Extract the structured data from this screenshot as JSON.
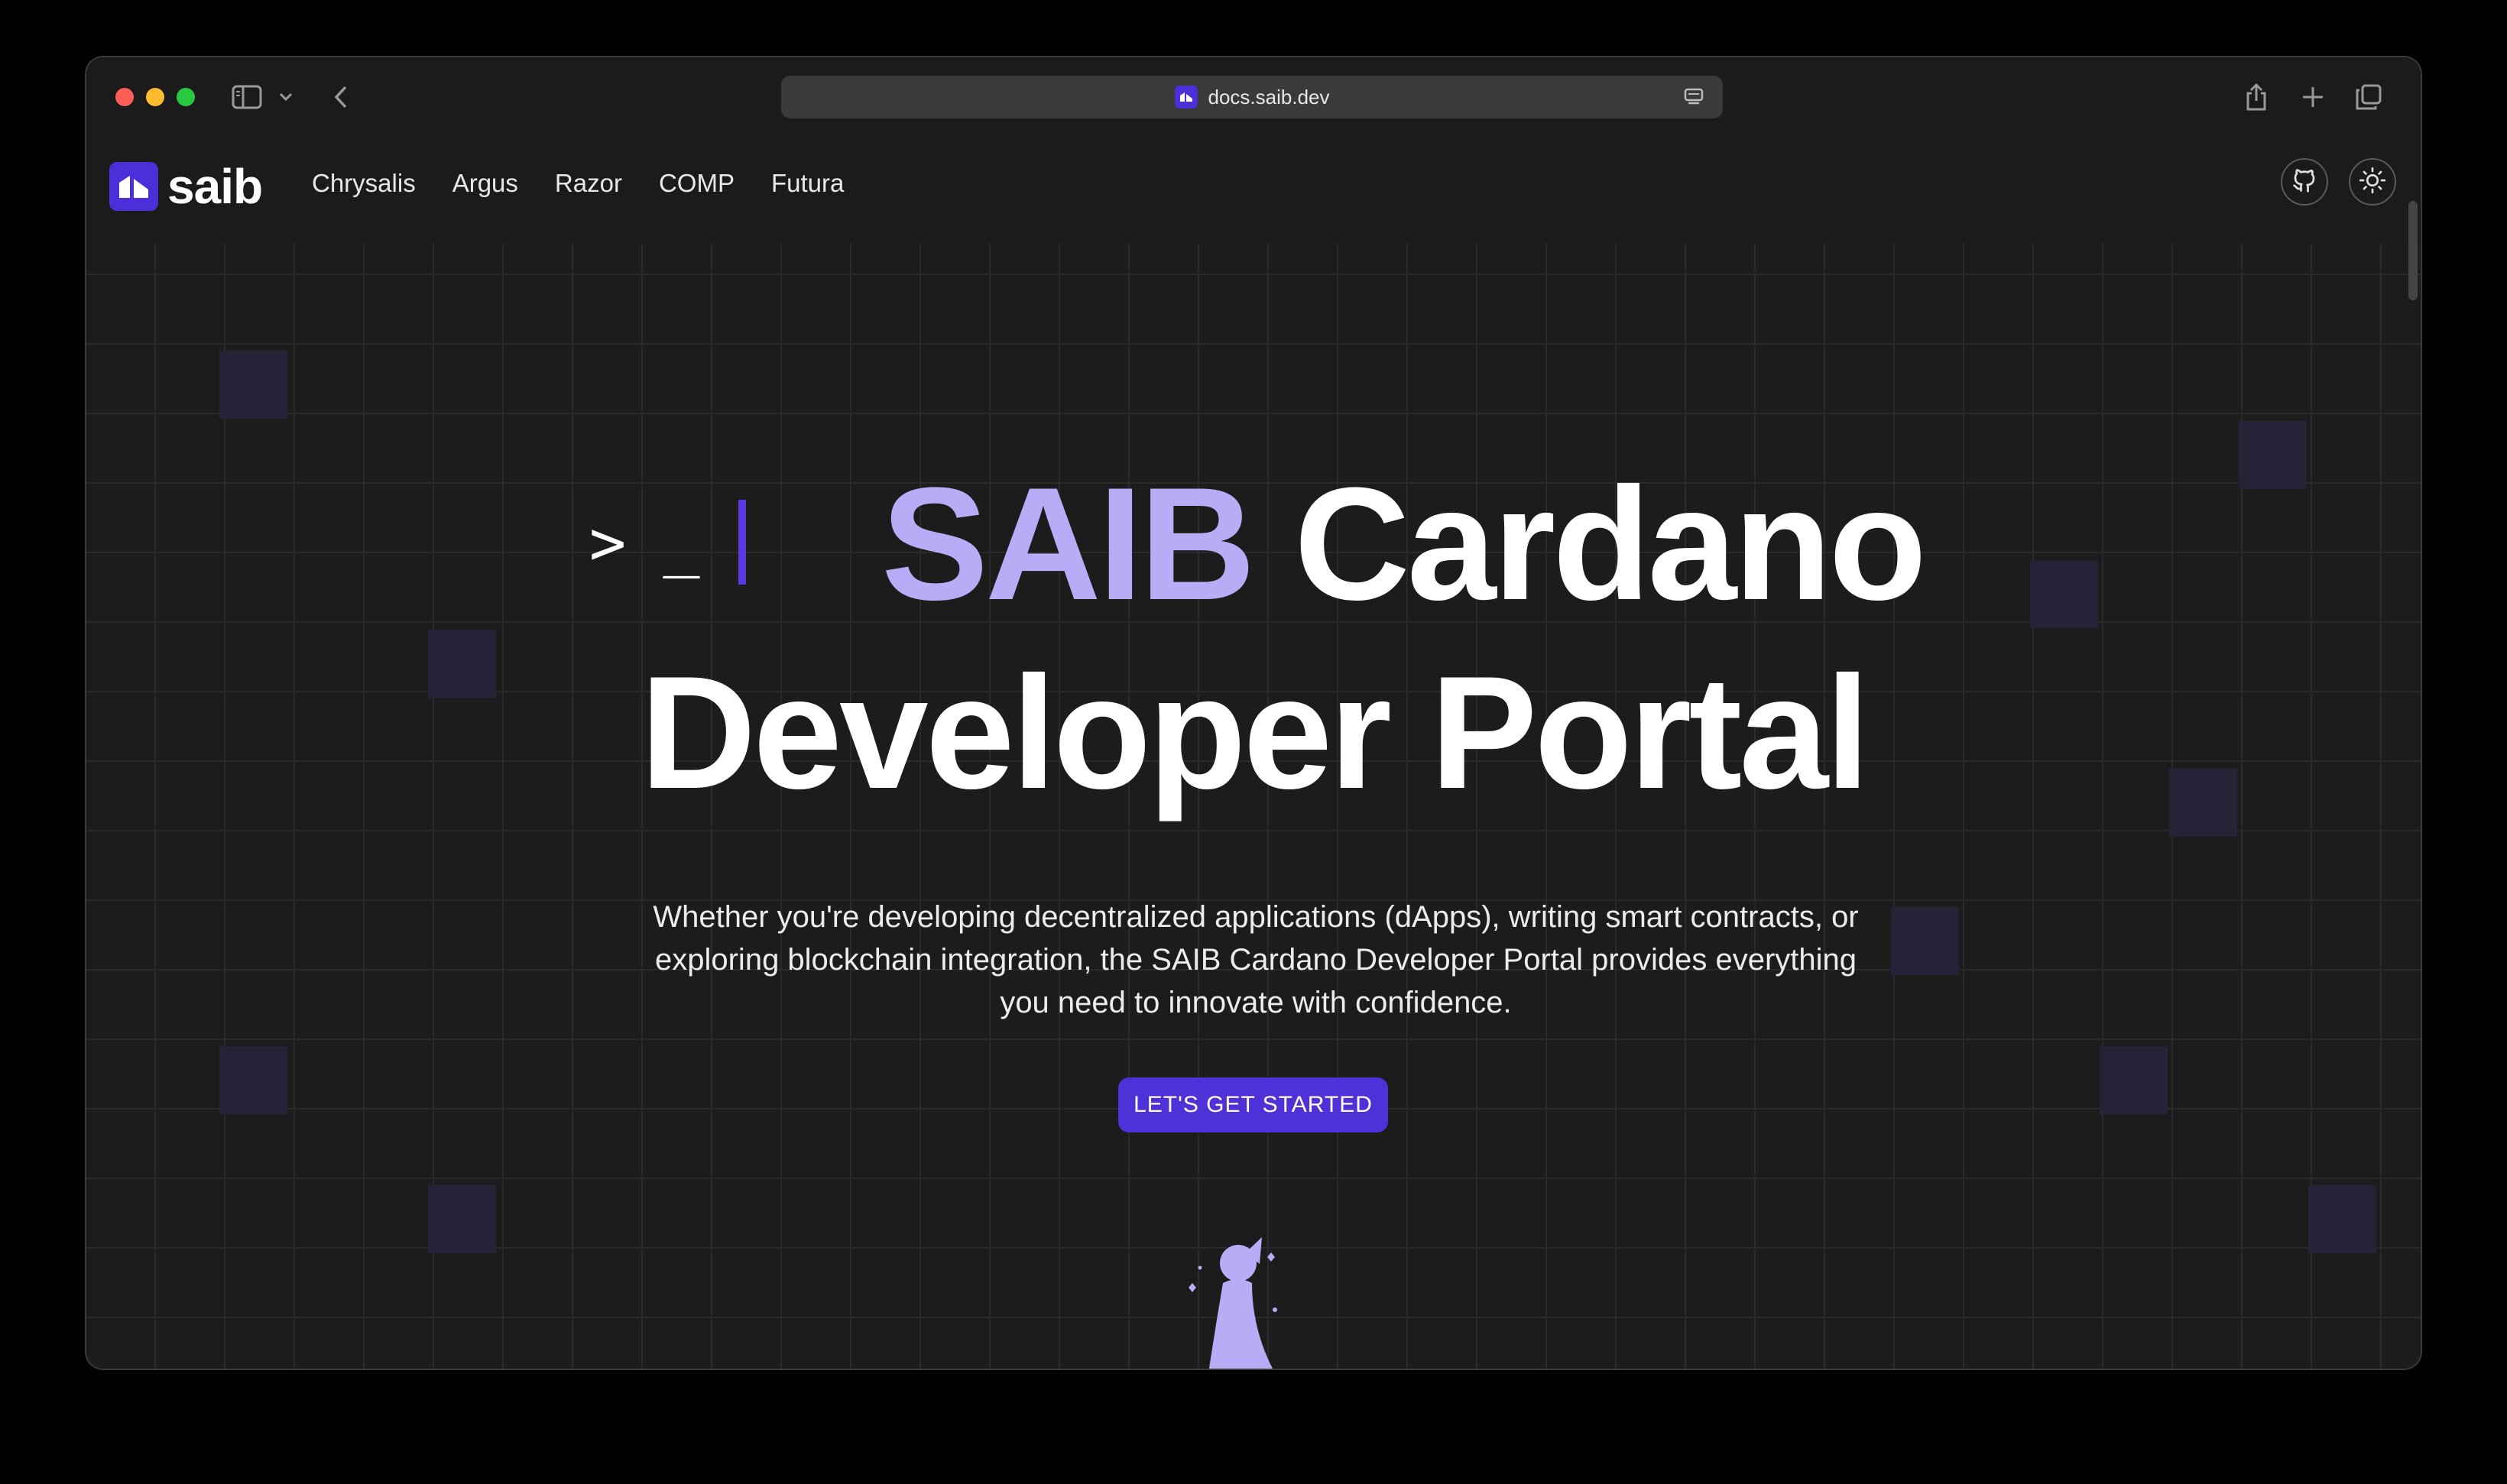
{
  "browser": {
    "url": "docs.saib.dev"
  },
  "site": {
    "logo_text": "saib",
    "nav": [
      "Chrysalis",
      "Argus",
      "Razor",
      "COMP",
      "Futura"
    ]
  },
  "hero": {
    "prompt": "> _",
    "title_highlight": "SAIB",
    "title_rest": "Cardano",
    "title_line2": "Developer Portal",
    "subtitle": "Whether you're developing decentralized applications (dApps), writing smart contracts, or exploring blockchain integration, the SAIB Cardano Developer Portal provides everything you need to innovate with confidence.",
    "cta": "LET'S GET STARTED"
  },
  "colors": {
    "accent": "#4e32d7",
    "highlight": "#b7acf5",
    "background": "#1c1c1c"
  },
  "icons": {
    "github": "github-icon",
    "theme": "sun-icon"
  }
}
